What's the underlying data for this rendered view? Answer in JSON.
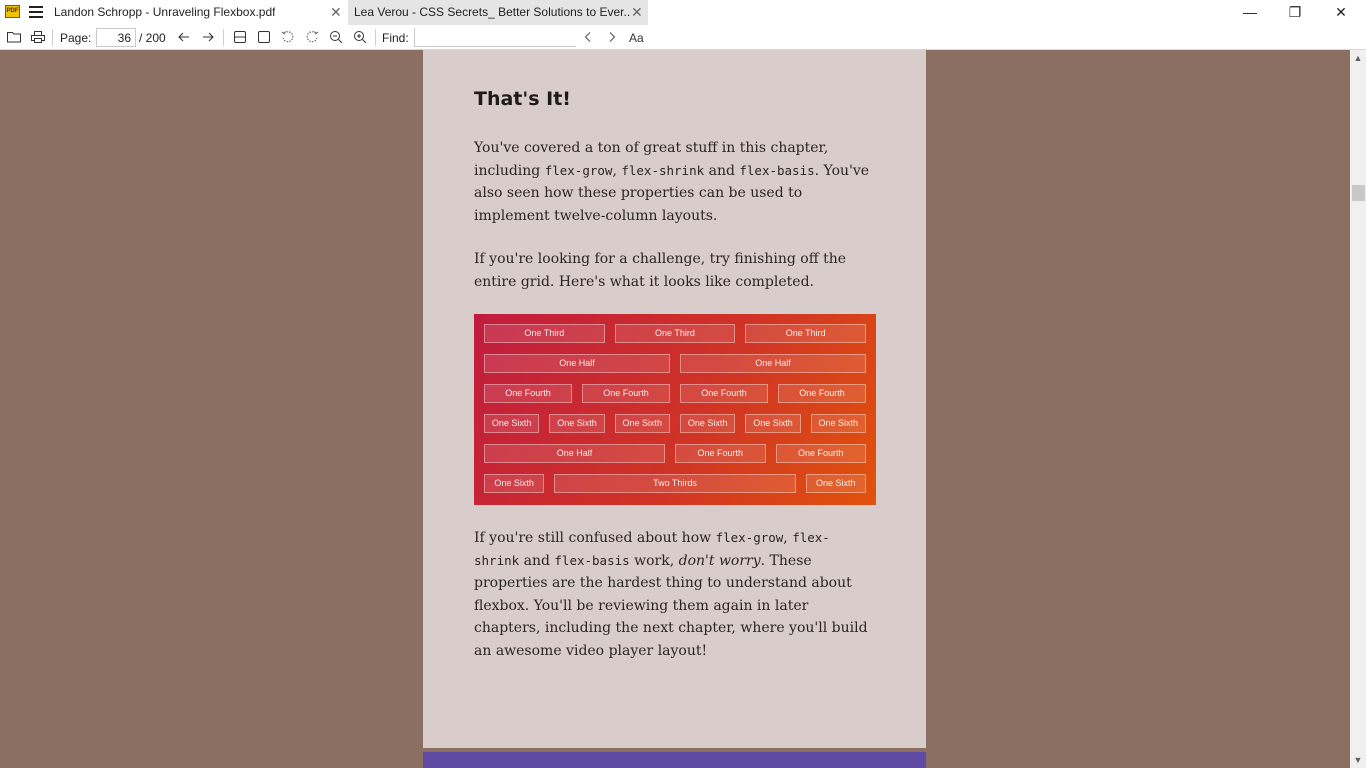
{
  "tabs": [
    {
      "label": "Landon Schropp - Unraveling Flexbox.pdf",
      "close": "✕",
      "active": true
    },
    {
      "label": "Lea Verou - CSS Secrets_ Better Solutions to Ever...",
      "close": "✕",
      "active": false
    }
  ],
  "app": {
    "logo_text": "PDF"
  },
  "window": {
    "minimize": "—",
    "maximize": "❐",
    "close": "✕"
  },
  "toolbar": {
    "page_label": "Page:",
    "current_page": "36",
    "total_pages": "/ 200",
    "find_label": "Find:",
    "find_value": "",
    "match_case_label": "Aa"
  },
  "icons": {
    "open": "folder-icon",
    "print": "printer-icon",
    "prev_page": "arrow-left-icon",
    "next_page": "arrow-right-icon",
    "continuous": "continuous-scroll-icon",
    "single_page": "single-page-icon",
    "rotate_left": "rotate-left-icon",
    "rotate_right": "rotate-right-icon",
    "zoom_out": "zoom-out-icon",
    "zoom_in": "zoom-in-icon",
    "find_prev": "chevron-left-icon",
    "find_next": "chevron-right-icon"
  },
  "document": {
    "heading": "That's It!",
    "p1": {
      "t1": "You've covered a ton of great stuff in this chapter, including ",
      "c1": "flex-grow",
      "t2": ", ",
      "c2": "flex-shrink",
      "t3": " and ",
      "c3": "flex-basis",
      "t4": ". You've also seen how these properties can be used to implement twelve-column layouts."
    },
    "p2": "If you're looking for a challenge, try finishing off the entire grid. Here's what it looks like completed.",
    "grid_rows": [
      [
        "One Third",
        "One Third",
        "One Third"
      ],
      [
        "One Half",
        "One Half"
      ],
      [
        "One Fourth",
        "One Fourth",
        "One Fourth",
        "One Fourth"
      ],
      [
        "One Sixth",
        "One Sixth",
        "One Sixth",
        "One Sixth",
        "One Sixth",
        "One Sixth"
      ],
      [
        "One Half",
        "One Fourth",
        "One Fourth"
      ],
      [
        "One Sixth",
        "Two Thirds",
        "One Sixth"
      ]
    ],
    "p3": {
      "t1": "If you're still confused about how ",
      "c1": "flex-grow",
      "t2": ", ",
      "c2": "flex-shrink",
      "t3": " and ",
      "c3": "flex-basis",
      "t4": " work, ",
      "em": "don't worry",
      "t5": ". These properties are the hardest thing to understand about flexbox. You'll be reviewing them again in later chapters, including the next chapter, where you'll build an awesome video player layout!"
    }
  },
  "colors": {
    "background": "#8c6f63",
    "page": "#d8cdcb",
    "grid_gradient_start": "#c01c3e",
    "grid_gradient_end": "#e1520c",
    "next_page": "#5e4aa2"
  }
}
